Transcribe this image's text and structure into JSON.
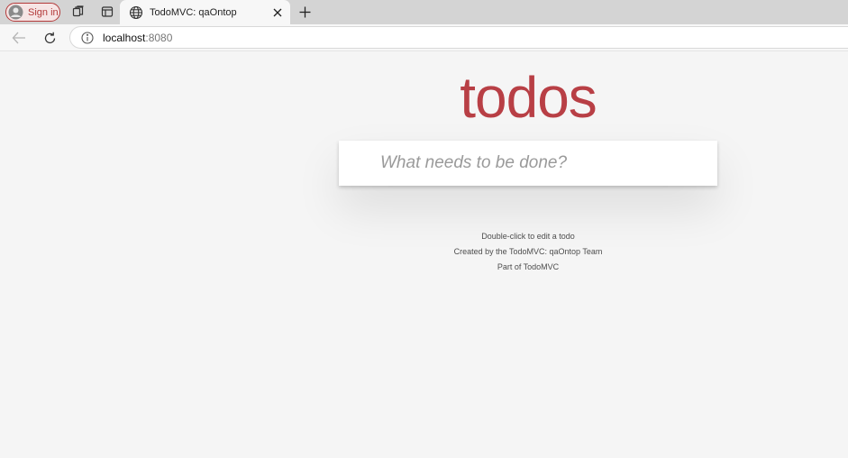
{
  "browser": {
    "sign_in_label": "Sign in",
    "tab_title": "TodoMVC: qaOntop",
    "url_host": "localhost",
    "url_port": ":8080",
    "icons": {
      "profile": "person-icon",
      "workspaces": "workspaces-icon",
      "tab_actions": "tab-actions-icon",
      "favicon": "globe-icon",
      "close_tab": "close-icon",
      "new_tab": "plus-icon",
      "back": "arrow-left-icon",
      "reload": "reload-icon",
      "site_info": "info-icon"
    }
  },
  "app": {
    "title": "todos",
    "new_todo_placeholder": "What needs to be done?",
    "accent_color": "#b83f45"
  },
  "footer": {
    "line1": "Double-click to edit a todo",
    "line2": "Created by the TodoMVC: qaOntop Team",
    "line3": "Part of TodoMVC"
  }
}
